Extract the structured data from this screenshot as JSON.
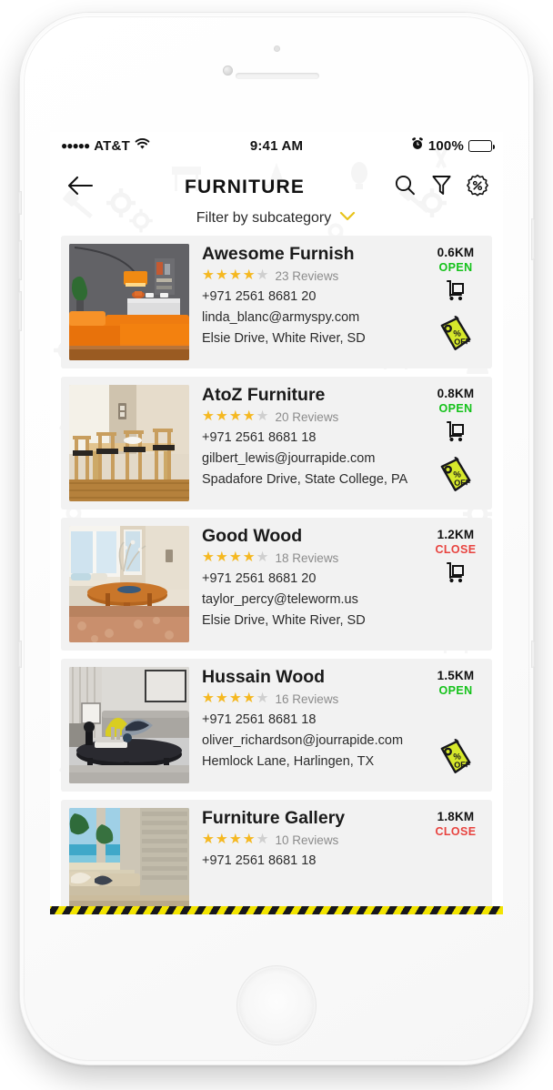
{
  "status_bar": {
    "signal_dots": "●●●●●",
    "carrier": "AT&T",
    "wifi_icon": "wifi-icon",
    "time": "9:41 AM",
    "alarm_icon": "alarm-clock-icon",
    "battery_percent": "100%",
    "battery_icon": "battery-full-icon"
  },
  "header": {
    "back_icon": "arrow-left-icon",
    "title": "FURNITURE",
    "actions": [
      {
        "name": "search-icon",
        "label": "Search"
      },
      {
        "name": "filter-funnel-icon",
        "label": "Filter"
      },
      {
        "name": "discount-badge-icon",
        "label": "Offers"
      }
    ],
    "subcategory_label": "Filter by subcategory",
    "subcategory_chevron": "chevron-down-icon",
    "chevron_color": "#e8c31a"
  },
  "colors": {
    "accent_yellow": "#e8c31a",
    "open_green": "#14c21a",
    "close_red": "#e8433f",
    "star_gold": "#f5b820",
    "star_empty": "#cfcfcf",
    "card_bg": "#f2f2f2",
    "offer_tag": "#d6e82b",
    "hazard_yellow": "#f2e400",
    "hazard_dark": "#17171c"
  },
  "listing": [
    {
      "name": "Awesome Furnish",
      "stars_filled": 4,
      "stars_total": 5,
      "reviews": "23 Reviews",
      "phone": "+971 2561 8681 20",
      "email": "linda_blanc@armyspy.com",
      "address": "Elsie Drive, White River, SD",
      "distance": "0.6KM",
      "status": "OPEN",
      "has_dolly_icon": true,
      "has_offer_tag": true,
      "offer_tag_text": "% OFF",
      "thumb": "orange-sectional-sofa-lamp"
    },
    {
      "name": "AtoZ Furniture",
      "stars_filled": 4,
      "stars_total": 5,
      "reviews": "20 Reviews",
      "phone": "+971 2561 8681 18",
      "email": "gilbert_lewis@jourrapide.com",
      "address": "Spadafore Drive, State College, PA",
      "distance": "0.8KM",
      "status": "OPEN",
      "has_dolly_icon": true,
      "has_offer_tag": true,
      "offer_tag_text": "% OFF",
      "thumb": "wooden-dining-table-chairs"
    },
    {
      "name": "Good Wood",
      "stars_filled": 4,
      "stars_total": 5,
      "reviews": "18 Reviews",
      "phone": "+971 2561 8681 20",
      "email": "taylor_percy@teleworm.us",
      "address": "Elsie Drive, White River, SD",
      "distance": "1.2KM",
      "status": "CLOSE",
      "has_dolly_icon": true,
      "has_offer_tag": false,
      "offer_tag_text": "",
      "thumb": "round-table-bay-window"
    },
    {
      "name": "Hussain Wood",
      "stars_filled": 4,
      "stars_total": 5,
      "reviews": "16 Reviews",
      "phone": "+971 2561 8681 18",
      "email": "oliver_richardson@jourrapide.com",
      "address": "Hemlock Lane, Harlingen, TX",
      "distance": "1.5KM",
      "status": "OPEN",
      "has_dolly_icon": false,
      "has_offer_tag": true,
      "offer_tag_text": "% OFF",
      "thumb": "grey-sofa-coffee-table"
    },
    {
      "name": "Furniture Gallery",
      "stars_filled": 4,
      "stars_total": 5,
      "reviews": "10 Reviews",
      "phone": "+971 2561 8681 18",
      "email": "",
      "address": "",
      "distance": "1.8KM",
      "status": "CLOSE",
      "has_dolly_icon": false,
      "has_offer_tag": false,
      "offer_tag_text": "",
      "thumb": "patio-sofa-ocean-view"
    }
  ]
}
